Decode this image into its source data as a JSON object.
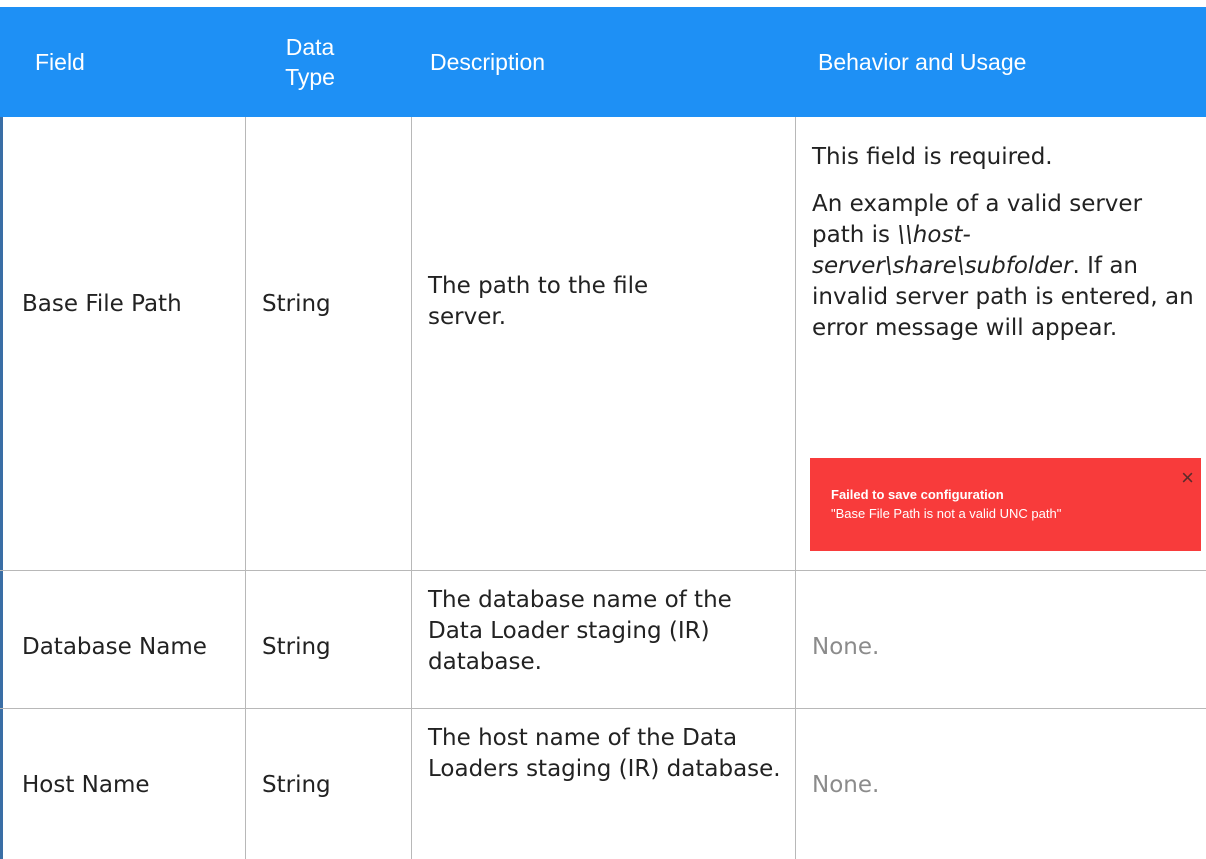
{
  "headers": {
    "field": "Field",
    "data_type": "Data Type",
    "description": "Description",
    "behavior": "Behavior and Usage"
  },
  "rows": [
    {
      "field": "Base File Path",
      "data_type": "String",
      "description": "The path to the file server.",
      "behavior": {
        "p1": "This field is required.",
        "p2_before": "An example of a valid server path is ",
        "p2_example": "\\\\host-server\\share\\subfolder",
        "p2_after": ". If an invalid server path is entered, an error message will appear."
      },
      "toast": {
        "title": "Failed to save configuration",
        "message": "\"Base File Path is not a valid UNC path\"",
        "close_icon": "×"
      }
    },
    {
      "field": "Database Name",
      "data_type": "String",
      "description": "The database name of the Data Loader staging (IR) database.",
      "behavior": "None."
    },
    {
      "field": "Host Name",
      "data_type": "String",
      "description": "The host name of the Data Loaders staging (IR) database.",
      "behavior": "None."
    }
  ],
  "colors": {
    "header_bg": "#1e90f5",
    "header_text": "#ffffff",
    "toast_bg": "#f83b3b"
  }
}
